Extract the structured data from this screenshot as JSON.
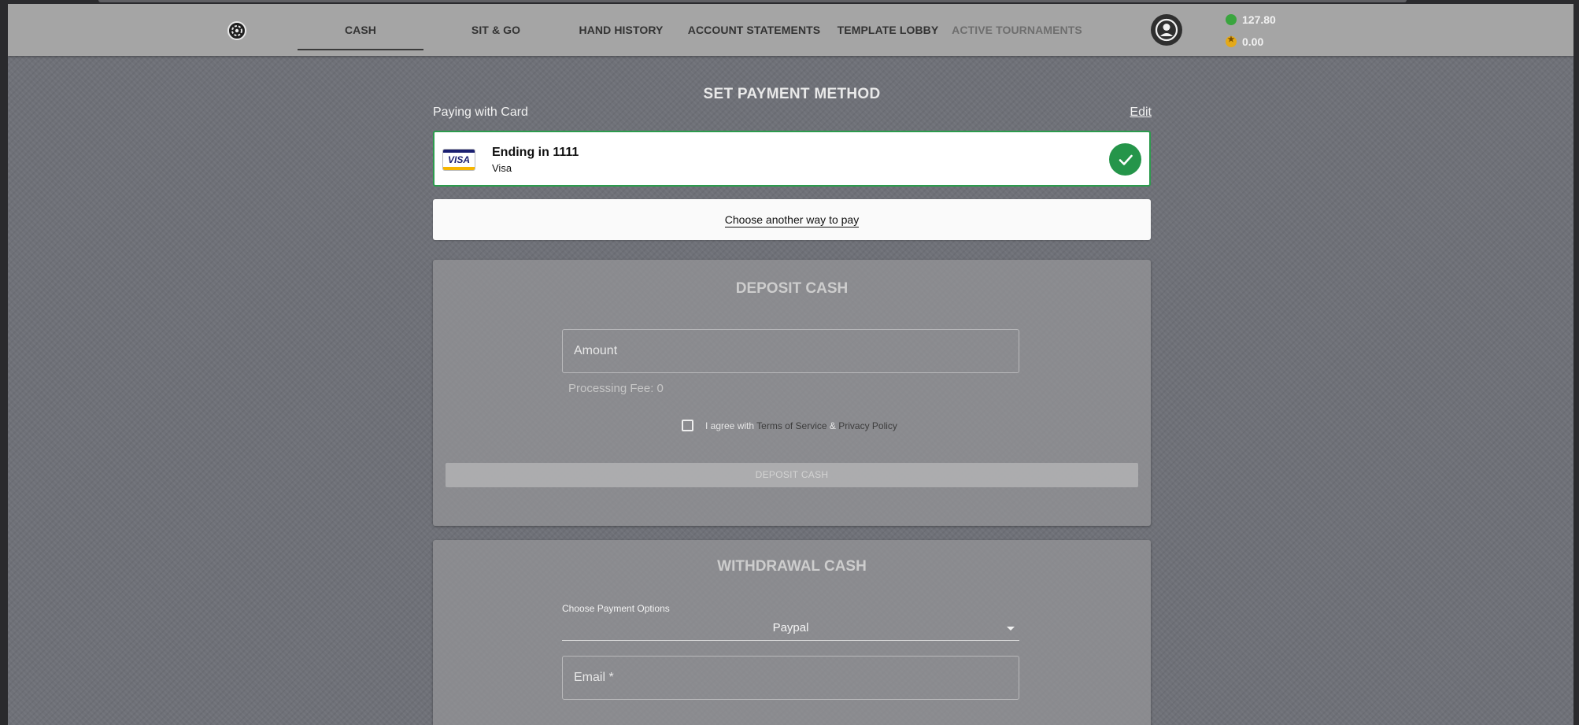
{
  "nav": {
    "tabs": [
      {
        "label": "CASH",
        "active": true
      },
      {
        "label": "SIT & GO"
      },
      {
        "label": "HAND HISTORY"
      },
      {
        "label": "ACCOUNT STATEMENTS"
      },
      {
        "label": "TEMPLATE LOBBY"
      },
      {
        "label": "ACTIVE TOURNAMENTS",
        "disabled": true
      }
    ],
    "balances": {
      "cash": "127.80",
      "points": "0.00",
      "cash_color": "#3aa53e",
      "points_color": "#e4a919"
    }
  },
  "payment": {
    "title": "SET PAYMENT METHOD",
    "paying_with": "Paying with Card",
    "edit": "Edit",
    "card": {
      "title": "Ending in 1111",
      "brand": "Visa",
      "logo_text": "VISA",
      "selected": true
    },
    "choose_another": "Choose another way to pay"
  },
  "deposit": {
    "title": "DEPOSIT CASH",
    "amount_placeholder": "Amount",
    "fee": "Processing Fee: 0",
    "agree_prefix": "I agree with",
    "terms": "Terms of Service",
    "amp": "&",
    "privacy": "Privacy Policy",
    "button": "DEPOSIT CASH"
  },
  "withdrawal": {
    "title": "WITHDRAWAL CASH",
    "select_label": "Choose Payment Options",
    "select_value": "Paypal",
    "email_placeholder": "Email *"
  },
  "colors": {
    "accent_green": "#25954a",
    "navbar_bg": "#a5a5a5",
    "page_bg": "#6e7077"
  }
}
